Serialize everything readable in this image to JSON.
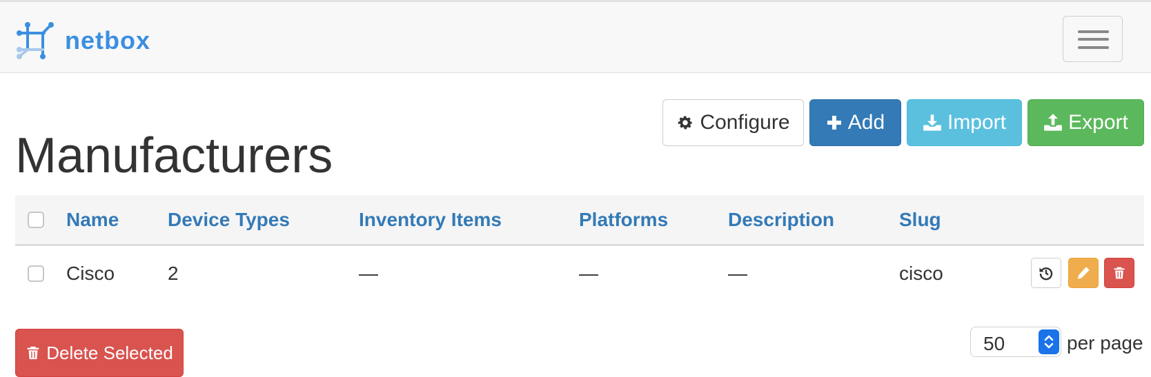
{
  "navbar": {
    "brand": "netbox",
    "colors": {
      "brand": "#3b8fe0",
      "logo_light": "#a8c8ec"
    }
  },
  "toolbar": {
    "configure_label": "Configure",
    "add_label": "Add",
    "import_label": "Import",
    "export_label": "Export"
  },
  "page": {
    "title": "Manufacturers"
  },
  "table": {
    "columns": [
      "Name",
      "Device Types",
      "Inventory Items",
      "Platforms",
      "Description",
      "Slug"
    ],
    "rows": [
      {
        "name": "Cisco",
        "device_types": "2",
        "inventory_items": "—",
        "platforms": "—",
        "description": "—",
        "slug": "cisco"
      }
    ]
  },
  "footer": {
    "delete_selected_label": "Delete Selected",
    "per_page_value": "50",
    "per_page_label": "per page"
  },
  "colors": {
    "primary": "#337ab7",
    "info": "#5bc0de",
    "success": "#5cb85c",
    "warning": "#f0ad4e",
    "danger": "#d9534f"
  },
  "icons": [
    "gear-icon",
    "plus-icon",
    "download-icon",
    "upload-icon",
    "history-icon",
    "pencil-icon",
    "trash-icon",
    "menu-icon"
  ]
}
